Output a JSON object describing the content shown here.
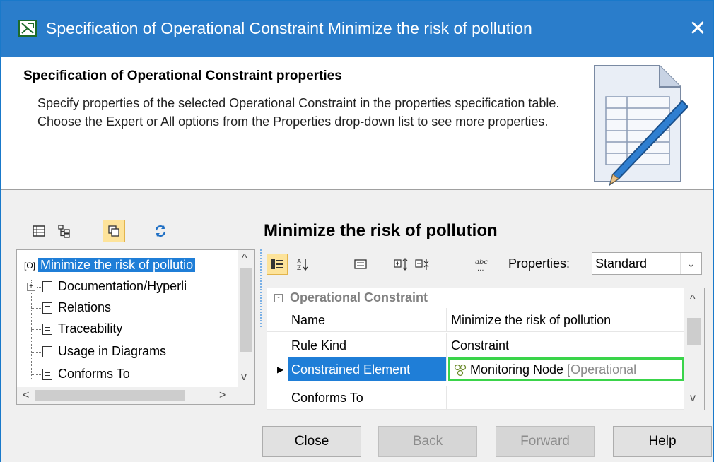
{
  "window": {
    "title": "Specification of Operational Constraint Minimize the risk of pollution",
    "close_glyph": "✕"
  },
  "header": {
    "title": "Specification of Operational Constraint properties",
    "description": "Specify properties of the selected Operational Constraint in the properties specification table. Choose the Expert or All options from the Properties drop-down list to see more properties.",
    "icon": "document-pencil-icon"
  },
  "left_toolbar": {
    "buttons": [
      "table-view-icon",
      "tree-view-icon",
      "copy-icon",
      "refresh-icon"
    ],
    "active_index": 2
  },
  "tree": {
    "root_badge": "[O]",
    "root_label": "Minimize the risk of pollutio",
    "items": [
      {
        "label": "Documentation/Hyperli",
        "expandable": true
      },
      {
        "label": "Relations",
        "expandable": false
      },
      {
        "label": "Traceability",
        "expandable": false
      },
      {
        "label": "Usage in Diagrams",
        "expandable": false
      },
      {
        "label": "Conforms To",
        "expandable": false
      }
    ]
  },
  "panel": {
    "title": "Minimize the risk of pollution"
  },
  "properties_toolbar": {
    "label": "Properties:",
    "selected": "Standard"
  },
  "grid": {
    "section": "Operational Constraint",
    "rows": [
      {
        "key": "Name",
        "value": "Minimize the risk of pollution"
      },
      {
        "key": "Rule Kind",
        "value": "Constraint"
      },
      {
        "key": "Constrained Element",
        "value": "Monitoring Node",
        "value_type": "[Operational",
        "selected": true
      },
      {
        "key": "Conforms To",
        "value": ""
      }
    ]
  },
  "buttons": {
    "close": "Close",
    "back": "Back",
    "forward": "Forward",
    "help": "Help"
  },
  "colors": {
    "titlebar": "#2a7dcb",
    "selection": "#1f7ed7",
    "highlight_border": "#3ad44a"
  }
}
